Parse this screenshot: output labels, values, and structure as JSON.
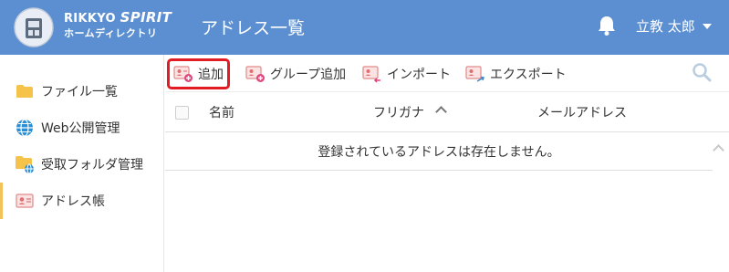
{
  "header": {
    "brand_top_a": "RIKKYO ",
    "brand_top_b": "SPIRIT",
    "brand_bottom": "ホームディレクトリ",
    "page_title": "アドレス一覧",
    "user_name": "立教 太郎",
    "colors": {
      "header_bg": "#5b8fd1",
      "text": "#ffffff"
    }
  },
  "sidebar": {
    "items": [
      {
        "label": "ファイル一覧",
        "icon": "folder-icon"
      },
      {
        "label": "Web公開管理",
        "icon": "globe-icon"
      },
      {
        "label": "受取フォルダ管理",
        "icon": "folder-globe-icon"
      },
      {
        "label": "アドレス帳",
        "icon": "address-card-icon",
        "active": true
      }
    ],
    "active_color": "#f3c25b"
  },
  "toolbar": {
    "add_label": "追加",
    "add_group_label": "グループ追加",
    "import_label": "インポート",
    "export_label": "エクスポート",
    "search_icon": "search-icon",
    "selected_outline": "#e31b23"
  },
  "table": {
    "columns": [
      "名前",
      "フリガナ",
      "メールアドレス"
    ],
    "sort_column": "フリガナ",
    "sort_direction": "ascending",
    "empty_message": "登録されているアドレスは存在しません。"
  }
}
